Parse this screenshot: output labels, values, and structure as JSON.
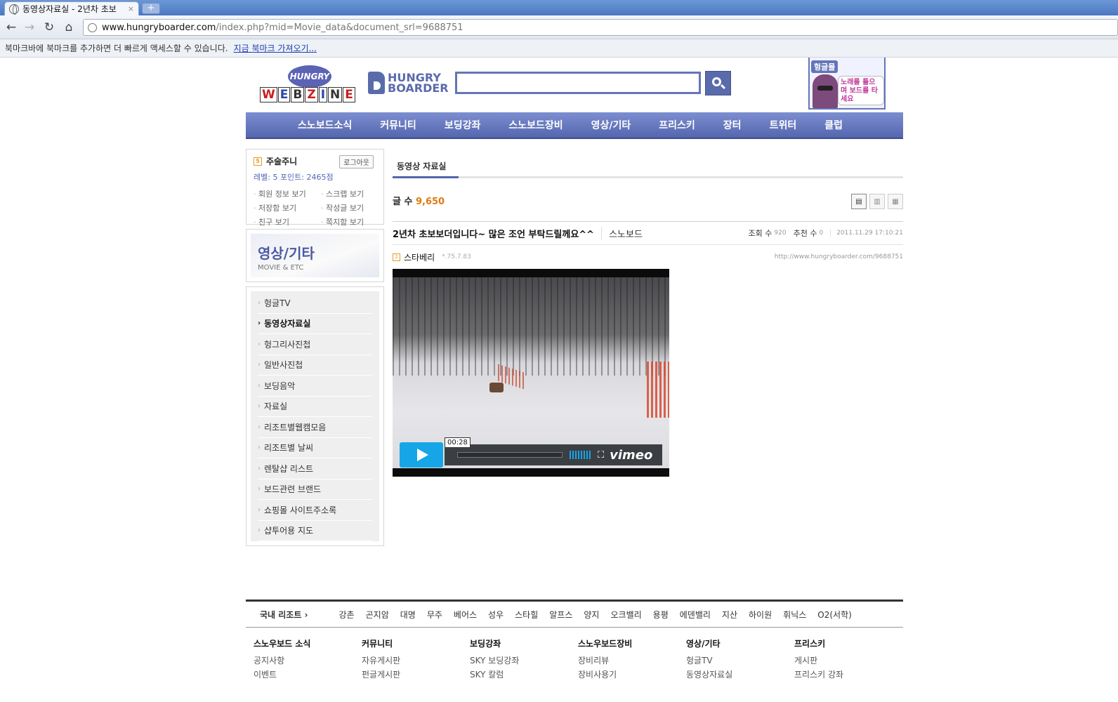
{
  "browser": {
    "tab_title": "동영상자료실 - 2년차 초보",
    "tab_close": "×",
    "new_tab": "+",
    "url_host": "www.hungryboarder.com",
    "url_path": "/index.php?mid=Movie_data&document_srl=9688751",
    "bookmark_prompt": "북마크바에 북마크를 추가하면 더 빠르게 액세스할 수 있습니다.",
    "bookmark_import": "지금 북마크 가져오기..."
  },
  "header": {
    "webzine_bubble": "HUNGRY",
    "webzine_letters": [
      "W",
      "E",
      "B",
      "Z",
      "I",
      "N",
      "E"
    ],
    "brand_line1": "HUNGRY",
    "brand_line2": "BOARDER",
    "search_value": "",
    "banner_tag": "헝글몰",
    "banner_msg": "노래를 틀으며 보드를 타세요"
  },
  "gnb": [
    "스노보드소식",
    "커뮤니티",
    "보딩강좌",
    "스노보드장비",
    "영상/기타",
    "프리스키",
    "장터",
    "트위터",
    "클럽"
  ],
  "login": {
    "level_icon": "5",
    "nickname": "주술주니",
    "logout": "로그아웃",
    "level_points": "레벨: 5  포인트: 2465점",
    "links": [
      "회원 정보 보기",
      "스크랩 보기",
      "저장함 보기",
      "작성글 보기",
      "친구 보기",
      "쪽지함 보기"
    ]
  },
  "category": {
    "title": "영상/기타",
    "subtitle": "MOVIE & ETC",
    "arrow": "›",
    "active_arrow": "›",
    "items": [
      "헝글TV",
      "동영상자료실",
      "헝그리사진첩",
      "일반사진첩",
      "보딩음악",
      "자료실",
      "리조트별웹캠모음",
      "리조트별 날씨",
      "렌탈샵 리스트",
      "보드관련 브랜드",
      "쇼핑몰 사이트주소록",
      "샵투어용 지도"
    ],
    "active_index": 1
  },
  "board": {
    "tab_label": "동영상 자료실",
    "count_label": "글 수",
    "count_value": "9,650",
    "view_icons": [
      "▤",
      "▥",
      "▦"
    ],
    "post_title": "2년차 초보보더입니다~ 많은 조언 부탁드릴께요^^",
    "post_category": "스노보드",
    "views_label": "조회 수",
    "views_value": "920",
    "recommend_label": "추천 수",
    "recommend_value": "0",
    "date": "2011.11.29 17:10:21",
    "author_level": "2",
    "author": "스타베리",
    "author_ip": "*.75.7.83",
    "permalink": "http://www.hungryboarder.com/9688751"
  },
  "video": {
    "time": "00:28",
    "fullscreen": "⛶",
    "brand": "vimeo"
  },
  "footer": {
    "resort_lead": "국내 리조트 ›",
    "resorts": [
      "강촌",
      "곤지암",
      "대명",
      "무주",
      "베어스",
      "성우",
      "스타힐",
      "알프스",
      "양지",
      "오크밸리",
      "용평",
      "에덴밸리",
      "지산",
      "하이원",
      "휘닉스",
      "O2(서학)"
    ],
    "sitemap": [
      {
        "title": "스노우보드 소식",
        "links": [
          "공지사항",
          "이벤트"
        ]
      },
      {
        "title": "커뮤니티",
        "links": [
          "자유게시판",
          "펀글게시판"
        ]
      },
      {
        "title": "보딩강좌",
        "links": [
          "SKY 보딩강좌",
          "SKY 칼럼"
        ]
      },
      {
        "title": "스노우보드장비",
        "links": [
          "장비리뷰",
          "장비사용기"
        ]
      },
      {
        "title": "영상/기타",
        "links": [
          "헝글TV",
          "동영상자료실"
        ]
      },
      {
        "title": "프리스키",
        "links": [
          "게시판",
          "프리스키 강좌"
        ]
      }
    ]
  }
}
